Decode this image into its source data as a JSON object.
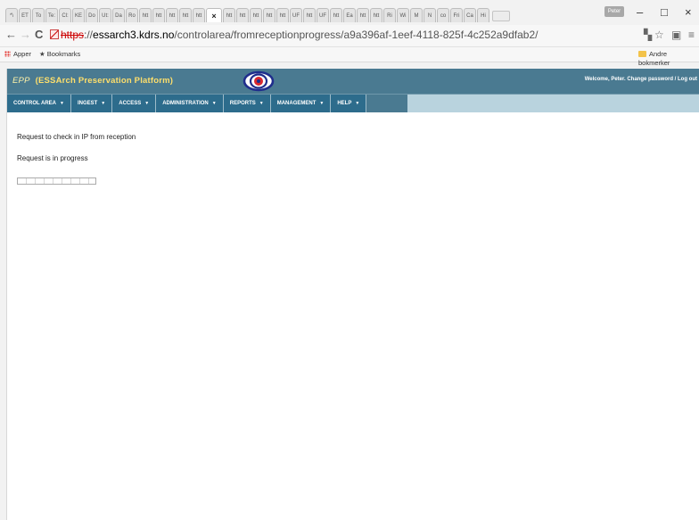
{
  "browser": {
    "tabs": [
      "*\\",
      "ET",
      "To",
      "Te:",
      "Cl:",
      "KE",
      "Do",
      "Ut:",
      "Da",
      "Ro",
      "htt",
      "htt",
      "htt",
      "htt",
      "htt",
      "×",
      "htt",
      "htt",
      "htt",
      "htt",
      "htt",
      "UF",
      "htt",
      "UF",
      "htt",
      "Ea",
      "htt",
      "htt",
      "Ri",
      "Wi",
      "M",
      "N",
      "co",
      "Fri",
      "Ca",
      "Hi"
    ],
    "profile_label": "Peter",
    "window_controls": {
      "minimize": "–",
      "maximize": "□",
      "close": "×"
    },
    "url": {
      "scheme": "https",
      "separator": "://",
      "host": "essarch3.kdrs.no",
      "path": "/controlarea/fromreceptionprogress/a9a396af-1eef-4118-825f-4c252a9dfab2/"
    },
    "bookmarks": {
      "apps": "Apper",
      "bookmarks": "Bookmarks",
      "other": "Andre bokmerker"
    }
  },
  "app": {
    "short": "EPP",
    "title": "(ESSArch Preservation Platform)",
    "welcome": "Welcome, Peter. Change password / Log out",
    "menu": [
      "CONTROL AREA",
      "INGEST",
      "ACCESS",
      "ADMINISTRATION",
      "REPORTS",
      "MANAGEMENT",
      "HELP"
    ],
    "content": {
      "request_text": "Request to check in IP from reception",
      "status_text": "Request is in progress"
    }
  },
  "colors": {
    "header_bg": "#4a7a91",
    "menu_bg": "#2d6c8c",
    "title_color": "#ffdf6b"
  }
}
